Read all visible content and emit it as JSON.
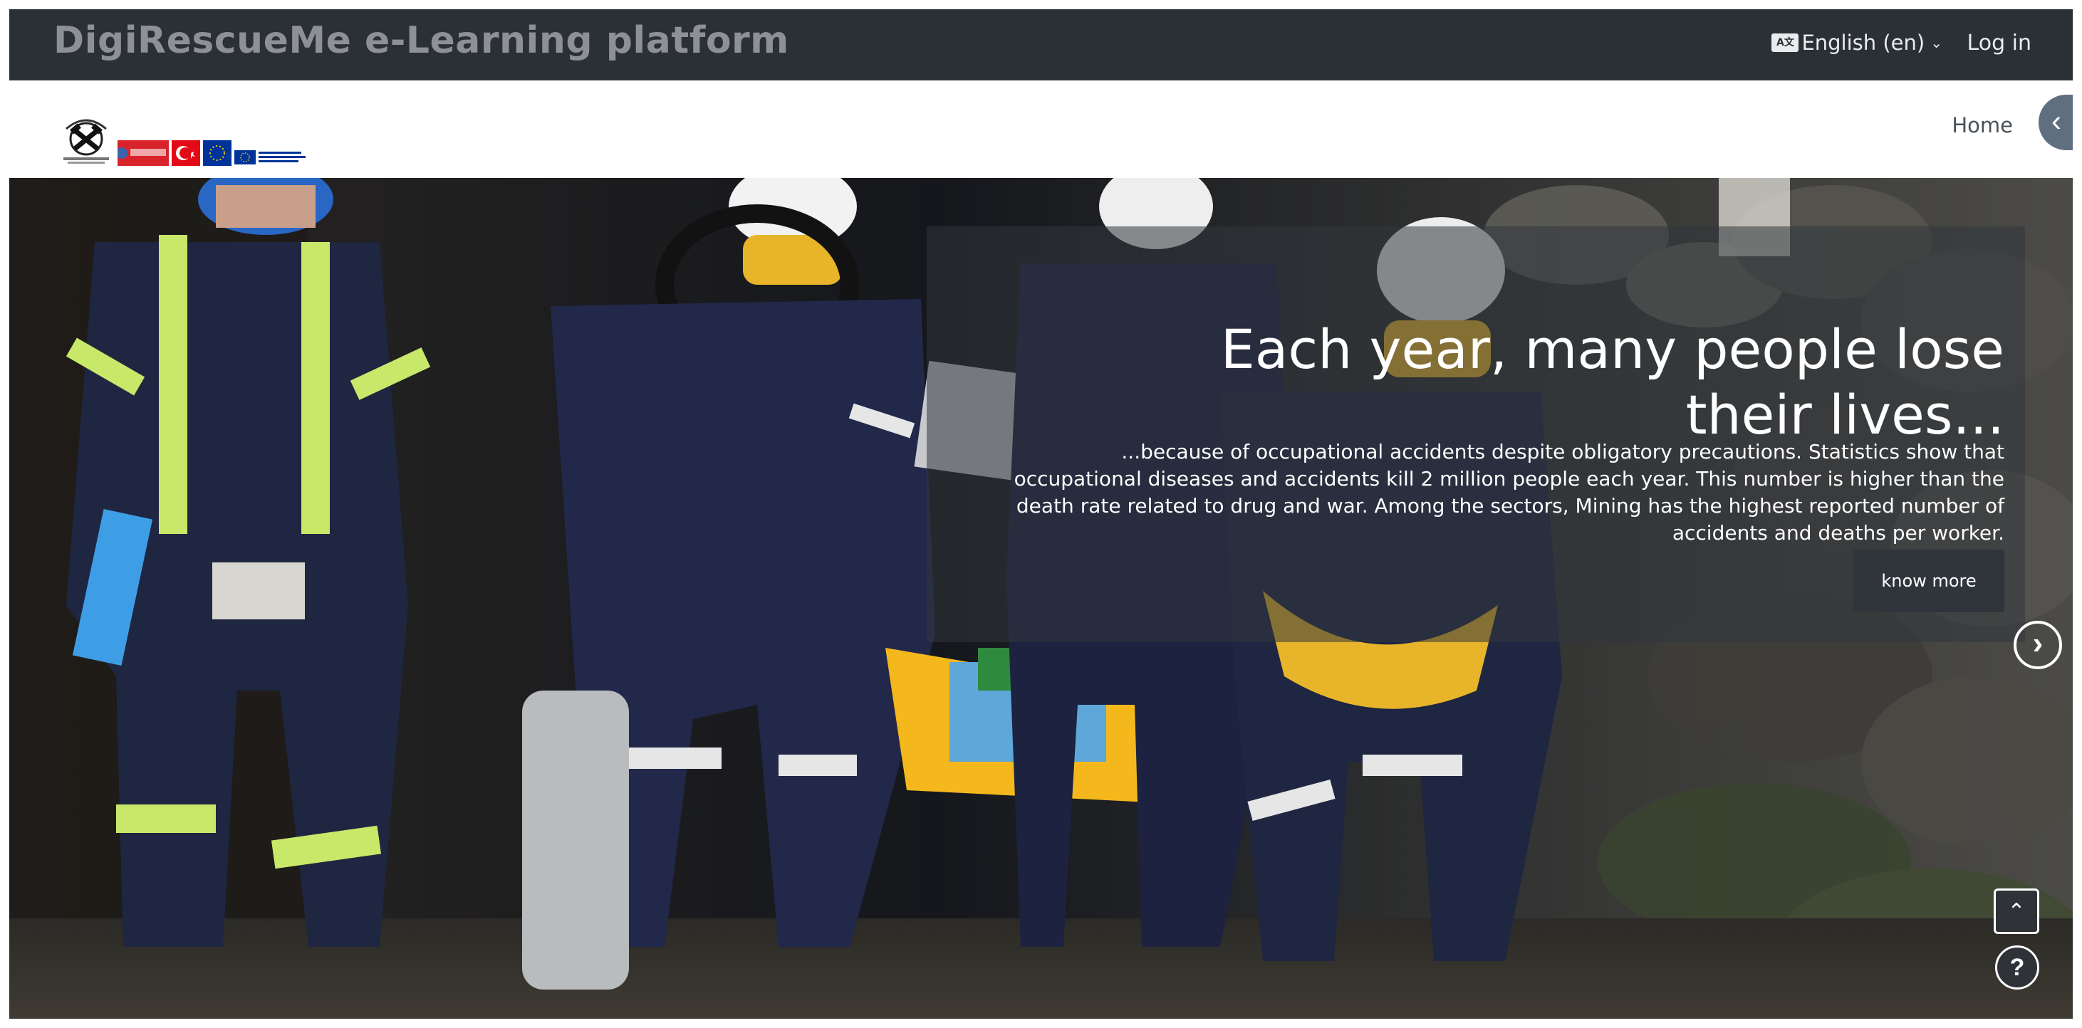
{
  "navbar": {
    "site_title": "DigiRescueMe e-Learning platform",
    "language_label": "English (en)",
    "login_label": "Log in"
  },
  "secondary_nav": {
    "home_label": "Home"
  },
  "logos": {
    "digirescueme_logo_text": "DigiRescueMe",
    "eu_funding_text": "Co-funded by the Erasmus+ Programme of the European Union"
  },
  "hero": {
    "title": "Each year, many people lose their lives...",
    "text": "...because of occupational accidents despite obligatory precautions. Statistics show that occupational diseases and accidents kill 2 million people each year. This number is higher than the death rate related to drug and war. Among the sectors, Mining has the highest reported number of accidents and deaths per worker.",
    "button_label": "know more"
  },
  "colors": {
    "navbar_bg": "#2b3035",
    "site_title": "#8d9196",
    "drawer_toggle": "#5f6f80",
    "stretcher": "#f4b81c",
    "reflective_stripe": "#c8e86a",
    "coverall": "#1f2641"
  },
  "icons": {
    "language": "language-icon",
    "language_chevron": "chevron-down-icon",
    "drawer": "chevron-left-icon",
    "carousel_next": "chevron-right-icon",
    "scroll_top": "chevron-up-icon",
    "help": "question-icon"
  }
}
